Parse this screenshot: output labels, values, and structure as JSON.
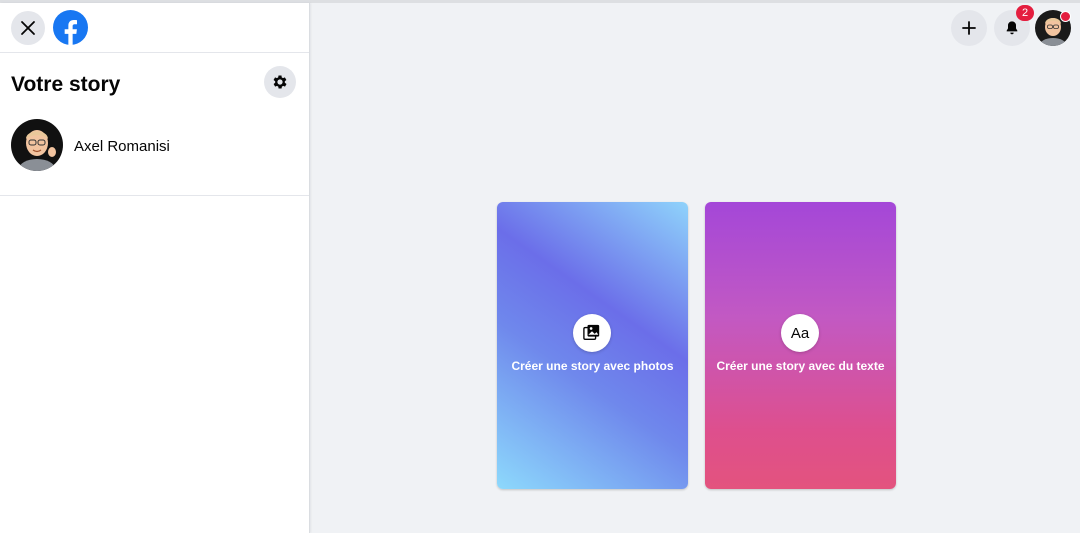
{
  "sidebar": {
    "title": "Votre story",
    "user": {
      "name": "Axel Romanisi"
    }
  },
  "topbar": {
    "notification_count": "2"
  },
  "cards": {
    "photo": {
      "label": "Créer une story avec photos",
      "icon": "photo-stack-icon"
    },
    "text": {
      "label": "Créer une story avec du texte",
      "icon_text": "Aa"
    }
  },
  "colors": {
    "brand": "#1877f2",
    "badge": "#e41e3f",
    "photo_card_gradient": [
      "#8fd3fb",
      "#6b6ee9",
      "#8dd9fc"
    ],
    "text_card_gradient": [
      "#a447d8",
      "#c259c3",
      "#e3537e"
    ]
  }
}
